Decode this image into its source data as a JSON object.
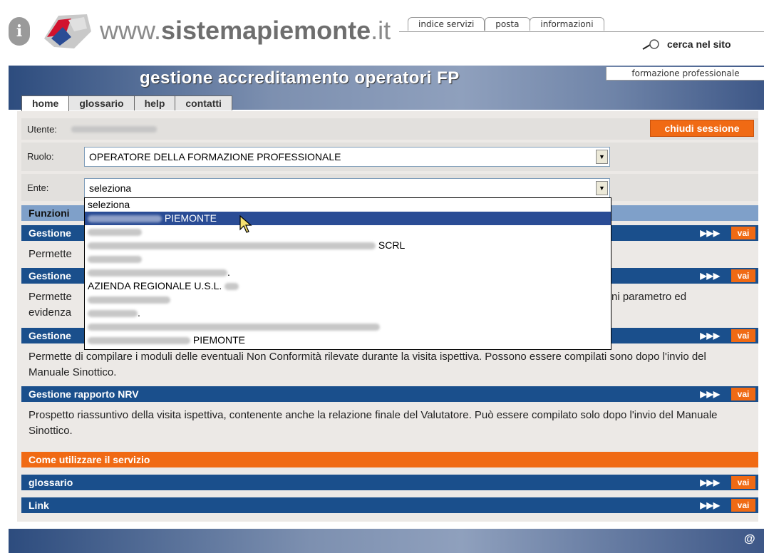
{
  "header": {
    "site_name_prefix": "www.",
    "site_name_bold": "sistemapiemonte",
    "site_name_suffix": ".it",
    "top_tabs": [
      "indice servizi",
      "posta",
      "informazioni"
    ],
    "search_label": "cerca nel sito"
  },
  "banner": {
    "title": "gestione accreditamento operatori FP",
    "subtitle": "formazione professionale",
    "nav_tabs": [
      "home",
      "glossario",
      "help",
      "contatti"
    ]
  },
  "session": {
    "utente_label": "Utente:",
    "logout_label": "chiudi sessione"
  },
  "form": {
    "ruolo_label": "Ruolo:",
    "ruolo_value": "OPERATORE DELLA FORMAZIONE PROFESSIONALE",
    "ente_label": "Ente:",
    "ente_value": "seleziona"
  },
  "dropdown": {
    "items": [
      {
        "text": "seleziona",
        "selected": false
      },
      {
        "text": "PIEMONTE",
        "selected": true
      },
      {
        "text": "",
        "selected": false
      },
      {
        "text": "SCRL",
        "selected": false
      },
      {
        "text": "",
        "selected": false
      },
      {
        "text": ".",
        "selected": false
      },
      {
        "text": "AZIENDA REGIONALE U.S.L.",
        "selected": false
      },
      {
        "text": "",
        "selected": false
      },
      {
        "text": ".",
        "selected": false
      },
      {
        "text": "",
        "selected": false
      },
      {
        "text": "PIEMONTE",
        "selected": false
      }
    ]
  },
  "functions": {
    "header": "Funzioni",
    "sections": [
      {
        "title": "Gestione",
        "desc": "Permette"
      },
      {
        "title": "Gestione",
        "desc_left": "Permette",
        "desc_left2": "evidenza",
        "desc_right": "ni parametro ed"
      },
      {
        "title": "Gestione",
        "desc": "Permette di compilare i moduli delle eventuali Non Conformità rilevate durante la visita ispettiva. Possono essere compilati sono dopo l'invio del Manuale Sinottico."
      },
      {
        "title": "Gestione rapporto NRV",
        "desc": "Prospetto riassuntivo della visita ispettiva, contenente anche la relazione finale del Valutatore. Può essere compilato solo dopo l'invio del Manuale Sinottico."
      }
    ],
    "arrows": "▶▶▶",
    "vai_label": "vai"
  },
  "bottom": {
    "come_utilizzare": "Come utilizzare il servizio",
    "glossario": "glossario",
    "link": "Link"
  },
  "footer": {
    "at": "@"
  },
  "colors": {
    "accent_orange": "#f06a14",
    "bar_blue": "#1a4f8c",
    "funzioni_blue": "#7fa0c9"
  }
}
